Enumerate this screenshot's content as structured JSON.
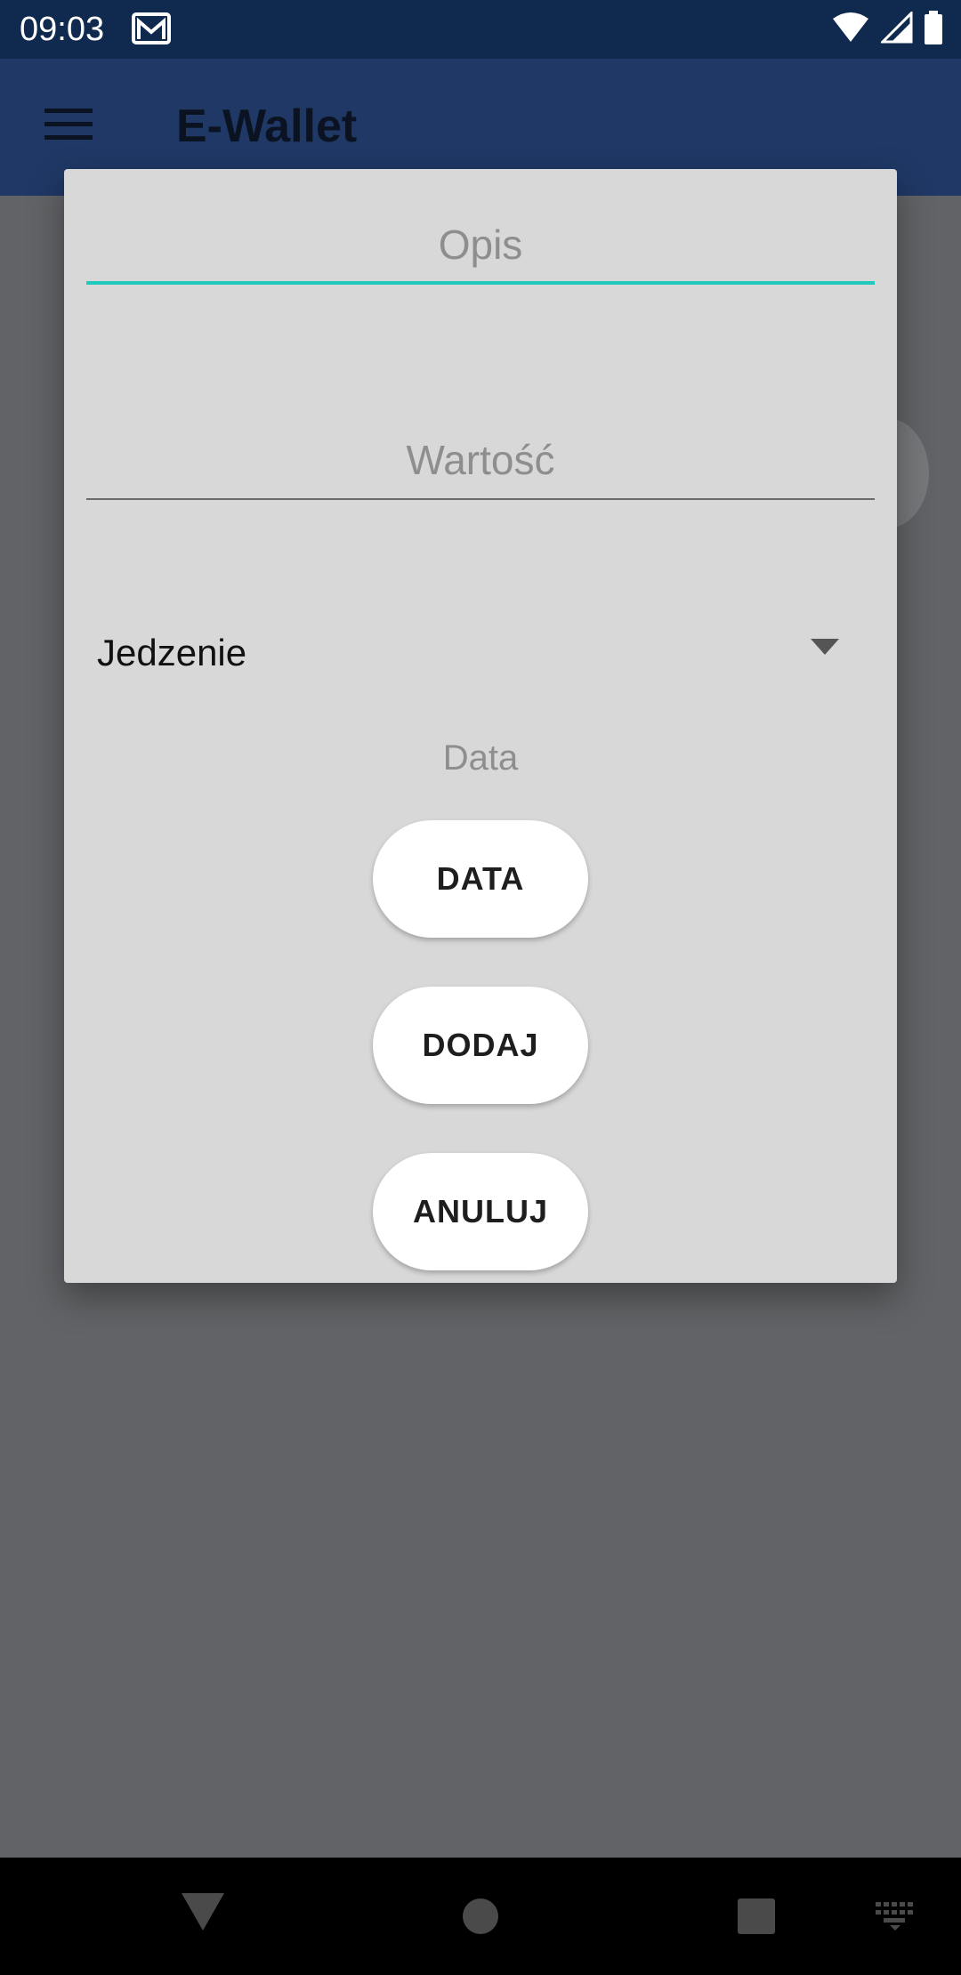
{
  "status_bar": {
    "time": "09:03",
    "icons": [
      "gmail-icon",
      "wifi-icon",
      "signal-icon",
      "battery-icon"
    ]
  },
  "app_bar": {
    "title": "E-Wallet",
    "menu_icon": "hamburger-menu-icon"
  },
  "dialog": {
    "description_placeholder": "Opis",
    "value_placeholder": "Wartość",
    "category_selected": "Jedzenie",
    "date_label": "Data",
    "date_button": "DATA",
    "add_button": "DODAJ",
    "cancel_button": "ANULUJ"
  },
  "nav_bar": {
    "icons": [
      "back-icon",
      "home-icon",
      "recents-icon",
      "keyboard-icon"
    ]
  },
  "colors": {
    "status_bar": "#102a4f",
    "app_bar": "#1f3865",
    "dialog_background": "#d8d8d8",
    "focused_underline": "#1fc9bb"
  }
}
